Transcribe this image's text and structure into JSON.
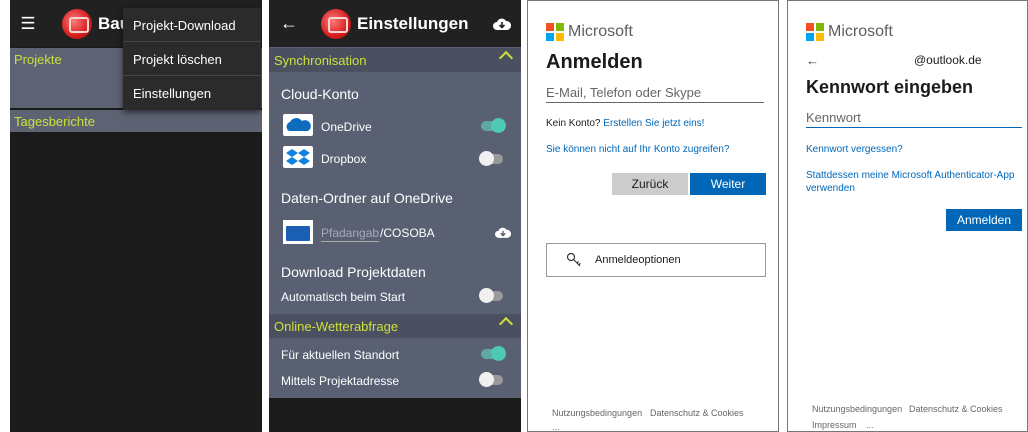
{
  "panel1": {
    "app_title": "Baut",
    "sections": [
      "Projekte",
      "Tagesberichte"
    ],
    "menu_items": [
      "Projekt-Download",
      "Projekt löschen",
      "Einstellungen"
    ]
  },
  "panel2": {
    "title": "Einstellungen",
    "sync_header": "Synchronisation",
    "cloud_label": "Cloud-Konto",
    "onedrive_label": "OneDrive",
    "onedrive_on": true,
    "dropbox_label": "Dropbox",
    "dropbox_on": false,
    "folder_label": "Daten-Ordner auf OneDrive",
    "path_placeholder": "Pfadangabe",
    "path_suffix": "/COSOBA",
    "download_label": "Download Projektdaten",
    "auto_start_label": "Automatisch beim Start",
    "auto_start_on": false,
    "weather_header": "Online-Wetterabfrage",
    "current_location_label": "Für aktuellen Standort",
    "current_location_on": true,
    "project_address_label": "Mittels Projektadresse",
    "project_address_on": false
  },
  "panel3": {
    "brand": "Microsoft",
    "heading": "Anmelden",
    "input_placeholder": "E-Mail, Telefon oder Skype",
    "no_account_text": "Kein Konto?",
    "create_link": "Erstellen Sie jetzt eins!",
    "cant_access_link": "Sie können nicht auf Ihr Konto zugreifen?",
    "back_button": "Zurück",
    "next_button": "Weiter",
    "signin_options": "Anmeldeoptionen",
    "footer_terms": "Nutzungsbedingungen",
    "footer_privacy": "Datenschutz & Cookies",
    "footer_more": "..."
  },
  "panel4": {
    "brand": "Microsoft",
    "back_arrow": "←",
    "account": "@outlook.de",
    "heading": "Kennwort eingeben",
    "input_placeholder": "Kennwort",
    "forgot_link": "Kennwort vergessen?",
    "authenticator_link": "Stattdessen meine Microsoft Authenticator-App verwenden",
    "signin_button": "Anmelden",
    "footer_terms": "Nutzungsbedingungen",
    "footer_privacy": "Datenschutz & Cookies",
    "footer_impressum": "Impressum",
    "footer_more": "..."
  },
  "colors": {
    "ms_red": "#f25022",
    "ms_green": "#7fba00",
    "ms_blue": "#00a4ef",
    "ms_yellow": "#ffb900",
    "accent_green": "#cde03b",
    "ms_button_blue": "#0067b8"
  },
  "icons": {
    "hamburger": "hamburger-icon",
    "back": "back-arrow-icon",
    "cloud_download": "cloud-download-icon",
    "key": "key-icon",
    "chevron_up": "chevron-up-icon"
  }
}
